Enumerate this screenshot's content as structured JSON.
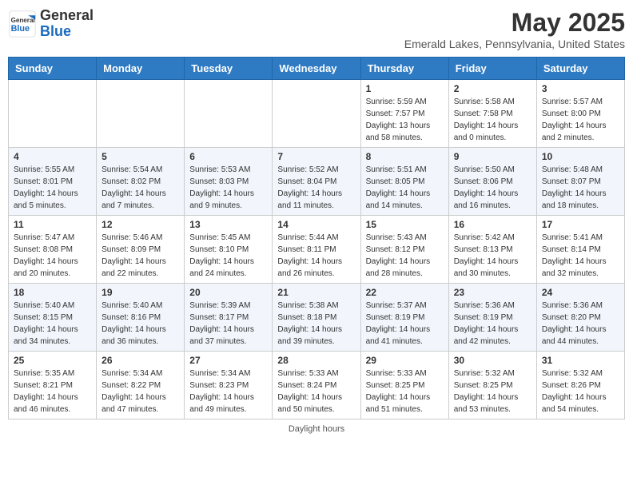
{
  "app": {
    "name": "GeneralBlue",
    "logo_text_line1": "General",
    "logo_text_line2": "Blue"
  },
  "title": "May 2025",
  "subtitle": "Emerald Lakes, Pennsylvania, United States",
  "footer": "Daylight hours",
  "days_of_week": [
    "Sunday",
    "Monday",
    "Tuesday",
    "Wednesday",
    "Thursday",
    "Friday",
    "Saturday"
  ],
  "weeks": [
    [
      {
        "day": "",
        "sunrise": "",
        "sunset": "",
        "daylight": ""
      },
      {
        "day": "",
        "sunrise": "",
        "sunset": "",
        "daylight": ""
      },
      {
        "day": "",
        "sunrise": "",
        "sunset": "",
        "daylight": ""
      },
      {
        "day": "",
        "sunrise": "",
        "sunset": "",
        "daylight": ""
      },
      {
        "day": "1",
        "sunrise": "Sunrise: 5:59 AM",
        "sunset": "Sunset: 7:57 PM",
        "daylight": "Daylight: 13 hours and 58 minutes."
      },
      {
        "day": "2",
        "sunrise": "Sunrise: 5:58 AM",
        "sunset": "Sunset: 7:58 PM",
        "daylight": "Daylight: 14 hours and 0 minutes."
      },
      {
        "day": "3",
        "sunrise": "Sunrise: 5:57 AM",
        "sunset": "Sunset: 8:00 PM",
        "daylight": "Daylight: 14 hours and 2 minutes."
      }
    ],
    [
      {
        "day": "4",
        "sunrise": "Sunrise: 5:55 AM",
        "sunset": "Sunset: 8:01 PM",
        "daylight": "Daylight: 14 hours and 5 minutes."
      },
      {
        "day": "5",
        "sunrise": "Sunrise: 5:54 AM",
        "sunset": "Sunset: 8:02 PM",
        "daylight": "Daylight: 14 hours and 7 minutes."
      },
      {
        "day": "6",
        "sunrise": "Sunrise: 5:53 AM",
        "sunset": "Sunset: 8:03 PM",
        "daylight": "Daylight: 14 hours and 9 minutes."
      },
      {
        "day": "7",
        "sunrise": "Sunrise: 5:52 AM",
        "sunset": "Sunset: 8:04 PM",
        "daylight": "Daylight: 14 hours and 11 minutes."
      },
      {
        "day": "8",
        "sunrise": "Sunrise: 5:51 AM",
        "sunset": "Sunset: 8:05 PM",
        "daylight": "Daylight: 14 hours and 14 minutes."
      },
      {
        "day": "9",
        "sunrise": "Sunrise: 5:50 AM",
        "sunset": "Sunset: 8:06 PM",
        "daylight": "Daylight: 14 hours and 16 minutes."
      },
      {
        "day": "10",
        "sunrise": "Sunrise: 5:48 AM",
        "sunset": "Sunset: 8:07 PM",
        "daylight": "Daylight: 14 hours and 18 minutes."
      }
    ],
    [
      {
        "day": "11",
        "sunrise": "Sunrise: 5:47 AM",
        "sunset": "Sunset: 8:08 PM",
        "daylight": "Daylight: 14 hours and 20 minutes."
      },
      {
        "day": "12",
        "sunrise": "Sunrise: 5:46 AM",
        "sunset": "Sunset: 8:09 PM",
        "daylight": "Daylight: 14 hours and 22 minutes."
      },
      {
        "day": "13",
        "sunrise": "Sunrise: 5:45 AM",
        "sunset": "Sunset: 8:10 PM",
        "daylight": "Daylight: 14 hours and 24 minutes."
      },
      {
        "day": "14",
        "sunrise": "Sunrise: 5:44 AM",
        "sunset": "Sunset: 8:11 PM",
        "daylight": "Daylight: 14 hours and 26 minutes."
      },
      {
        "day": "15",
        "sunrise": "Sunrise: 5:43 AM",
        "sunset": "Sunset: 8:12 PM",
        "daylight": "Daylight: 14 hours and 28 minutes."
      },
      {
        "day": "16",
        "sunrise": "Sunrise: 5:42 AM",
        "sunset": "Sunset: 8:13 PM",
        "daylight": "Daylight: 14 hours and 30 minutes."
      },
      {
        "day": "17",
        "sunrise": "Sunrise: 5:41 AM",
        "sunset": "Sunset: 8:14 PM",
        "daylight": "Daylight: 14 hours and 32 minutes."
      }
    ],
    [
      {
        "day": "18",
        "sunrise": "Sunrise: 5:40 AM",
        "sunset": "Sunset: 8:15 PM",
        "daylight": "Daylight: 14 hours and 34 minutes."
      },
      {
        "day": "19",
        "sunrise": "Sunrise: 5:40 AM",
        "sunset": "Sunset: 8:16 PM",
        "daylight": "Daylight: 14 hours and 36 minutes."
      },
      {
        "day": "20",
        "sunrise": "Sunrise: 5:39 AM",
        "sunset": "Sunset: 8:17 PM",
        "daylight": "Daylight: 14 hours and 37 minutes."
      },
      {
        "day": "21",
        "sunrise": "Sunrise: 5:38 AM",
        "sunset": "Sunset: 8:18 PM",
        "daylight": "Daylight: 14 hours and 39 minutes."
      },
      {
        "day": "22",
        "sunrise": "Sunrise: 5:37 AM",
        "sunset": "Sunset: 8:19 PM",
        "daylight": "Daylight: 14 hours and 41 minutes."
      },
      {
        "day": "23",
        "sunrise": "Sunrise: 5:36 AM",
        "sunset": "Sunset: 8:19 PM",
        "daylight": "Daylight: 14 hours and 42 minutes."
      },
      {
        "day": "24",
        "sunrise": "Sunrise: 5:36 AM",
        "sunset": "Sunset: 8:20 PM",
        "daylight": "Daylight: 14 hours and 44 minutes."
      }
    ],
    [
      {
        "day": "25",
        "sunrise": "Sunrise: 5:35 AM",
        "sunset": "Sunset: 8:21 PM",
        "daylight": "Daylight: 14 hours and 46 minutes."
      },
      {
        "day": "26",
        "sunrise": "Sunrise: 5:34 AM",
        "sunset": "Sunset: 8:22 PM",
        "daylight": "Daylight: 14 hours and 47 minutes."
      },
      {
        "day": "27",
        "sunrise": "Sunrise: 5:34 AM",
        "sunset": "Sunset: 8:23 PM",
        "daylight": "Daylight: 14 hours and 49 minutes."
      },
      {
        "day": "28",
        "sunrise": "Sunrise: 5:33 AM",
        "sunset": "Sunset: 8:24 PM",
        "daylight": "Daylight: 14 hours and 50 minutes."
      },
      {
        "day": "29",
        "sunrise": "Sunrise: 5:33 AM",
        "sunset": "Sunset: 8:25 PM",
        "daylight": "Daylight: 14 hours and 51 minutes."
      },
      {
        "day": "30",
        "sunrise": "Sunrise: 5:32 AM",
        "sunset": "Sunset: 8:25 PM",
        "daylight": "Daylight: 14 hours and 53 minutes."
      },
      {
        "day": "31",
        "sunrise": "Sunrise: 5:32 AM",
        "sunset": "Sunset: 8:26 PM",
        "daylight": "Daylight: 14 hours and 54 minutes."
      }
    ]
  ]
}
